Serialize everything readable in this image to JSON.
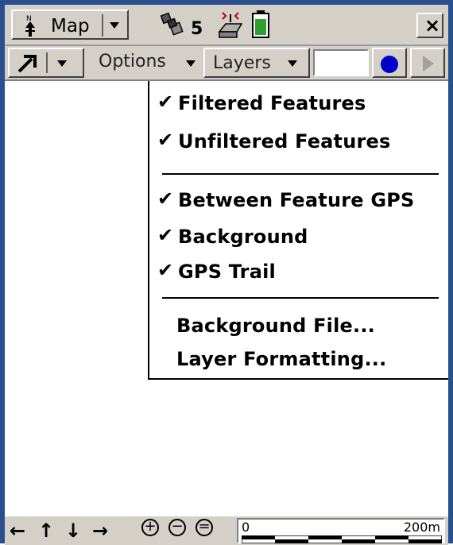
{
  "titlebar": {
    "view_label": "Map",
    "satellite_count": "5",
    "close_label": "×"
  },
  "toolbar": {
    "options_label": "Options",
    "layers_label": "Layers"
  },
  "layers_menu": {
    "items": [
      {
        "label": "Filtered Features",
        "checked": true
      },
      {
        "label": "Unfiltered Features",
        "checked": true
      },
      {
        "label": "Between Feature GPS",
        "checked": true
      },
      {
        "label": "Background",
        "checked": true
      },
      {
        "label": "GPS Trail",
        "checked": true
      },
      {
        "label": "Background File...",
        "checked": false
      },
      {
        "label": "Layer Formatting...",
        "checked": false
      }
    ],
    "check_glyph": "✔"
  },
  "bottombar": {
    "nav_left": "←",
    "nav_up": "↑",
    "nav_down": "↓",
    "nav_right": "→",
    "zoom_in": "+",
    "zoom_out": "−",
    "zoom_extent": "=",
    "scale_start": "0",
    "scale_end": "200m"
  },
  "colors": {
    "window_border": "#2a4f8f",
    "chrome": "#d4d0c8",
    "record_dot": "#0000c8",
    "battery_fill": "#2ea02e"
  },
  "icons": [
    "north-arrow-icon",
    "satellite-icon",
    "gps-receiver-icon",
    "battery-icon",
    "close-icon",
    "pan-arrow-icon",
    "record-icon",
    "play-icon"
  ]
}
